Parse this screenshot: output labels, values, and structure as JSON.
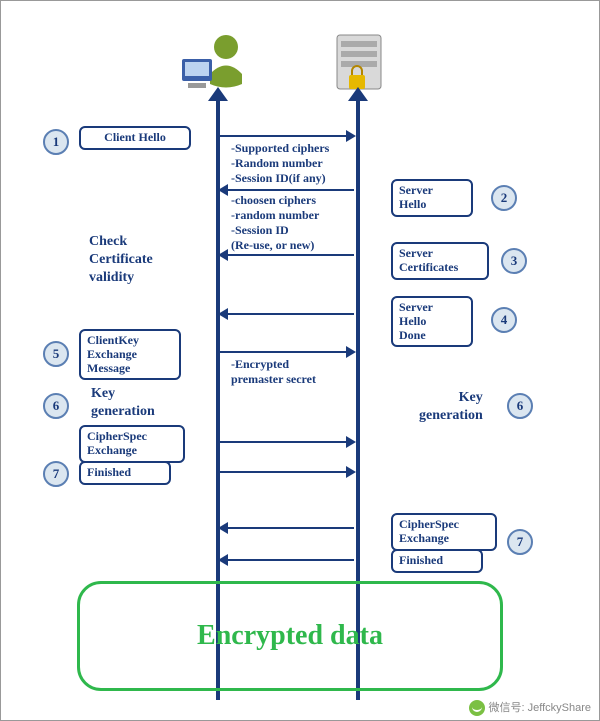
{
  "steps": {
    "s1": {
      "num": "1",
      "label": "Client Hello"
    },
    "s2": {
      "num": "2",
      "label": "Server\nHello"
    },
    "s3": {
      "num": "3",
      "label": "Server\nCertificates"
    },
    "s4": {
      "num": "4",
      "label": "Server\nHello\nDone"
    },
    "s5": {
      "num": "5",
      "label": "ClientKey\nExchange\nMessage"
    },
    "s6c": {
      "num": "6",
      "label": "Key\ngeneration"
    },
    "s6s": {
      "num": "6",
      "label": "Key\ngeneration"
    },
    "s7c": {
      "num": "7",
      "cipher": "CipherSpec\nExchange",
      "fin": "Finished"
    },
    "s7s": {
      "num": "7",
      "cipher": "CipherSpec\nExchange",
      "fin": "Finished"
    }
  },
  "midnotes": {
    "hello1": "-Supported ciphers\n-Random number\n-Session ID(if any)",
    "hello2": "-choosen ciphers\n-random number\n-Session ID\n(Re-use, or new)",
    "premaster": "-Encrypted\npremaster secret"
  },
  "sidenote": "Check\nCertificate\nvalidity",
  "encrypted": "Encrypted data",
  "watermark": "微信号: JeffckyShare"
}
